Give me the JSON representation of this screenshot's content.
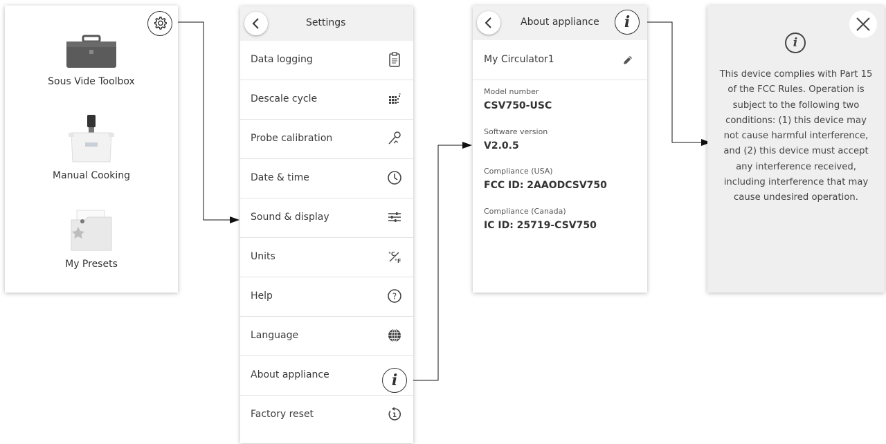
{
  "home": {
    "items": [
      {
        "label": "Sous Vide Toolbox",
        "icon": "toolbox-icon"
      },
      {
        "label": "Manual Cooking",
        "icon": "circulator-pot-icon"
      },
      {
        "label": "My Presets",
        "icon": "presets-folder-icon"
      }
    ],
    "settings_icon": "gear-icon"
  },
  "settings": {
    "title": "Settings",
    "back_icon": "chevron-left-icon",
    "items": [
      {
        "label": "Data logging",
        "icon": "clipboard-icon"
      },
      {
        "label": "Descale cycle",
        "icon": "descale-icon"
      },
      {
        "label": "Probe calibration",
        "icon": "probe-icon"
      },
      {
        "label": "Date & time",
        "icon": "clock-icon"
      },
      {
        "label": "Sound & display",
        "icon": "sliders-icon"
      },
      {
        "label": "Units",
        "icon": "units-icon"
      },
      {
        "label": "Help",
        "icon": "question-icon"
      },
      {
        "label": "Language",
        "icon": "globe-icon"
      },
      {
        "label": "About appliance",
        "icon": "info-icon"
      },
      {
        "label": "Factory reset",
        "icon": "reset-icon"
      }
    ]
  },
  "about": {
    "title": "About appliance",
    "device_name": "My Circulator1",
    "fields": [
      {
        "label": "Model number",
        "value": "CSV750-USC"
      },
      {
        "label": "Software version",
        "value": "V2.0.5"
      },
      {
        "label": "Compliance (USA)",
        "value": "FCC ID: 2AAODCSV750"
      },
      {
        "label": "Compliance (Canada)",
        "value": "IC ID: 25719-CSV750"
      }
    ],
    "info_glyph": "i"
  },
  "compliance": {
    "text": "This device complies with Part 15 of the FCC Rules. Operation is subject to the following two conditions: (1) this device may not cause harmful interference, and (2) this device must accept any interference received, including interference that may cause undesired operation."
  },
  "colors": {
    "background": "#ffffff",
    "header": "#f1f1f1",
    "compliance_panel": "#efefef",
    "text": "#3a3a3a"
  }
}
